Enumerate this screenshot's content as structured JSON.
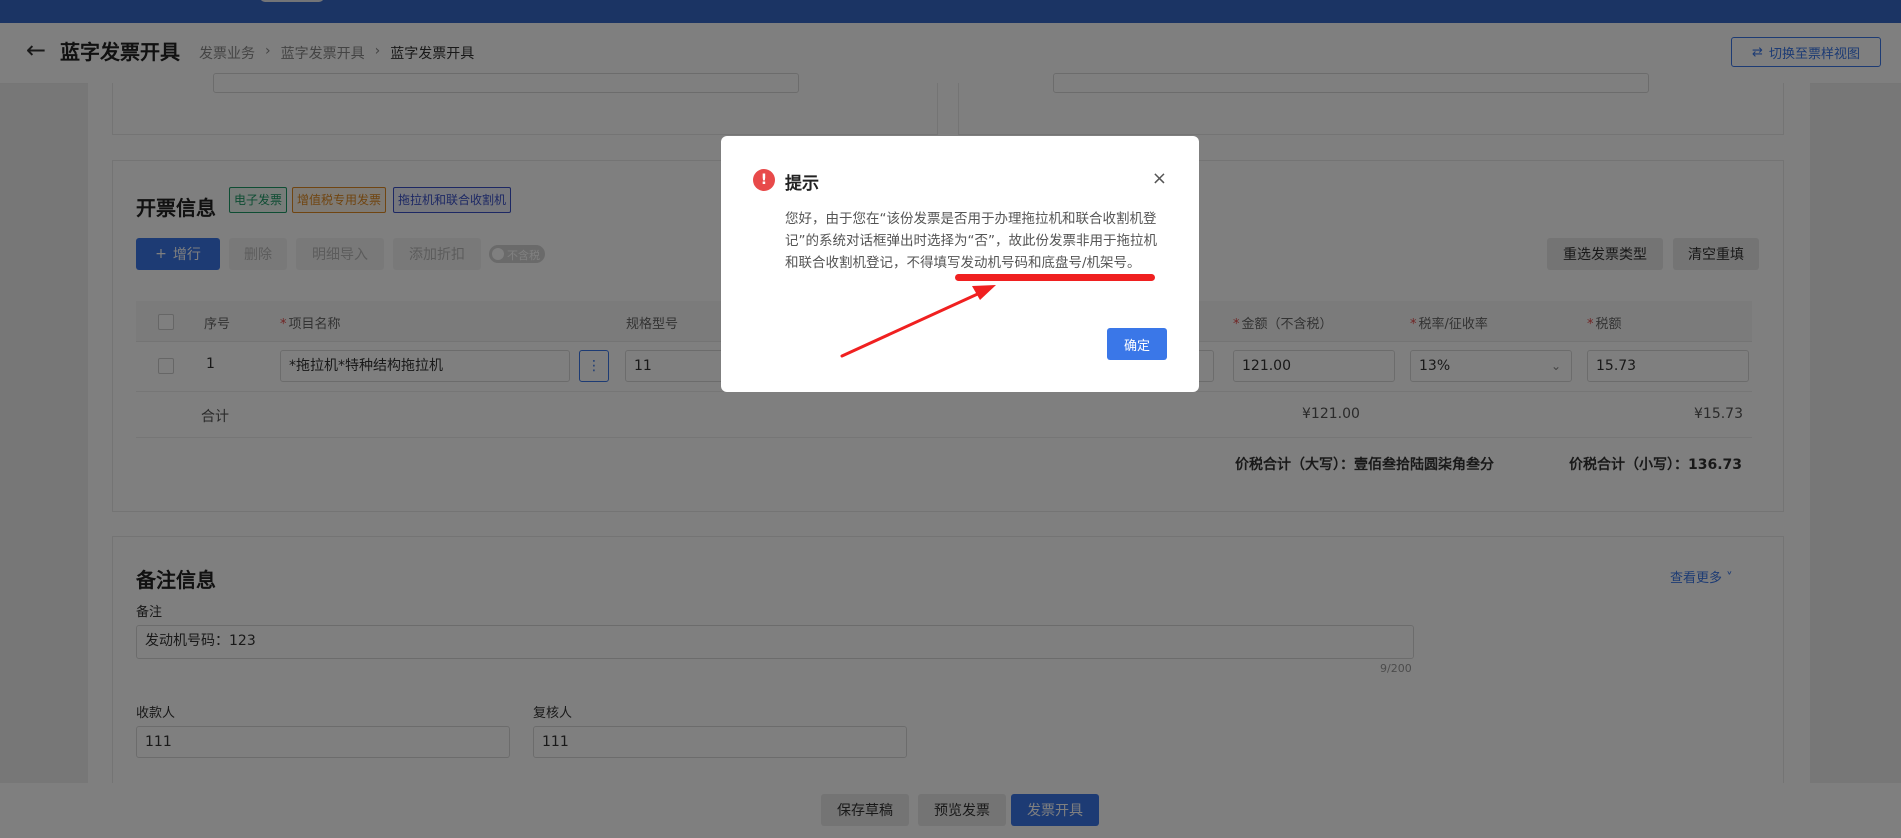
{
  "header": {
    "title": "蓝字发票开具",
    "breadcrumb": [
      "发票业务",
      "蓝字发票开具",
      "蓝字发票开具"
    ],
    "switch_view_label": "切换至票样视图"
  },
  "invoice_info": {
    "title": "开票信息",
    "tags": [
      "电子发票",
      "增值税专用发票",
      "拖拉机和联合收割机"
    ],
    "toolbar": {
      "add_row": "增行",
      "delete": "删除",
      "detail_import": "明细导入",
      "add_discount": "添加折扣",
      "tax_toggle": "不含税",
      "reselect_type": "重选发票类型",
      "clear_refill": "清空重填"
    },
    "columns": [
      "序号",
      "项目名称",
      "规格型号",
      "金额（不含税）",
      "税率/征收率",
      "税额"
    ],
    "row": {
      "index": "1",
      "item_name": "*拖拉机*特种结构拖拉机",
      "spec": "11",
      "amount": "121.00",
      "tax_rate": "13%",
      "tax": "15.73"
    },
    "sum_label": "合计",
    "sum_amount": "¥121.00",
    "sum_tax": "¥15.73",
    "total_upper_label": "价税合计（大写）：",
    "total_upper_value": "壹佰叁拾陆圆柒角叁分",
    "total_lower_label": "价税合计（小写）：",
    "total_lower_value": "136.73"
  },
  "remarks": {
    "title": "备注信息",
    "see_more": "查看更多",
    "remark_label": "备注",
    "remark_value": "发动机号码：123",
    "remark_count": "9/200",
    "payee_label": "收款人",
    "payee_value": "111",
    "reviewer_label": "复核人",
    "reviewer_value": "111"
  },
  "footer": {
    "save_draft": "保存草稿",
    "preview": "预览发票",
    "issue": "发票开具"
  },
  "dialog": {
    "title": "提示",
    "close": "×",
    "message_part1": "您好，由于您在“该份发票是否用于办理拖拉机和联合收割机登记”的系统对话框弹出时选择为“否”，故此份发票非用于拖拉机和联合收割机登记，",
    "message_part2": "不得填写发动机号码和底盘号/机架号。",
    "ok": "确定"
  },
  "colors": {
    "primary": "#3a77e8",
    "header_bar": "#3768c9",
    "danger": "#e84a4a",
    "annotation": "#f02020"
  }
}
